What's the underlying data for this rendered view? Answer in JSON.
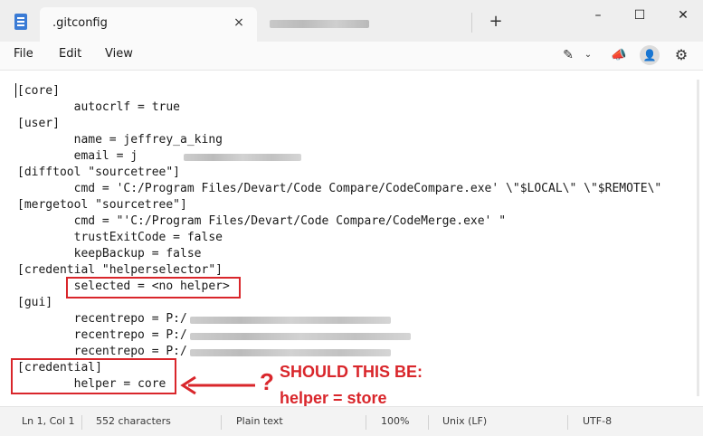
{
  "window": {
    "tab_title": ".gitconfig",
    "tab_close_glyph": "×",
    "new_tab_glyph": "+",
    "minimize_glyph": "–",
    "maximize_glyph": "☐",
    "close_glyph": "✕"
  },
  "menu": {
    "file": "File",
    "edit": "Edit",
    "view": "View"
  },
  "toolbar_icons": {
    "copilot": "copilot-icon",
    "copilot_glyph": "✎",
    "chevron_glyph": "⌄",
    "announce": "megaphone-icon",
    "announce_glyph": "📣",
    "avatar": "account-icon",
    "avatar_glyph": "👤",
    "settings": "gear-icon",
    "settings_glyph": "⚙"
  },
  "editor": {
    "lines": [
      "[core]",
      "        autocrlf = true",
      "[user]",
      "        name = jeffrey_a_king",
      "        email = j",
      "[difftool \"sourcetree\"]",
      "        cmd = 'C:/Program Files/Devart/Code Compare/CodeCompare.exe' \\\"$LOCAL\\\" \\\"$REMOTE\\\"",
      "[mergetool \"sourcetree\"]",
      "        cmd = \"'C:/Program Files/Devart/Code Compare/CodeMerge.exe' \"",
      "        trustExitCode = false",
      "        keepBackup = false",
      "[credential \"helperselector\"]",
      "        selected = <no helper>",
      "[gui]",
      "        recentrepo = P:/",
      "        recentrepo = P:/",
      "        recentrepo = P:/",
      "[credential]",
      "        helper = core"
    ]
  },
  "annotation": {
    "question_mark": "?",
    "line1": "SHOULD THIS BE:",
    "line2": "helper = store",
    "color": "#d9262b"
  },
  "status": {
    "position": "Ln 1, Col 1",
    "characters": "552 characters",
    "format": "Plain text",
    "zoom": "100%",
    "line_ending": "Unix (LF)",
    "encoding": "UTF-8"
  }
}
